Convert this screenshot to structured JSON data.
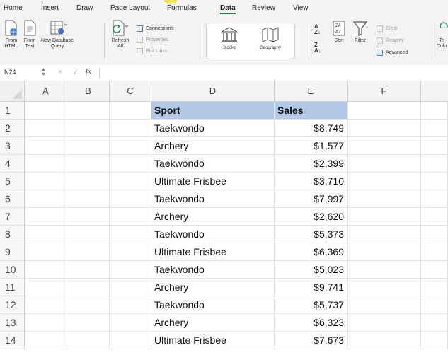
{
  "menu": {
    "tabs": [
      {
        "label": "Home"
      },
      {
        "label": "Insert"
      },
      {
        "label": "Draw"
      },
      {
        "label": "Page Layout"
      },
      {
        "label": "Formulas"
      },
      {
        "label": "Data",
        "active": true
      },
      {
        "label": "Review"
      },
      {
        "label": "View"
      }
    ]
  },
  "ribbon": {
    "from_html": "From\nHTML",
    "from_text": "From\nText",
    "new_db_query": "New Database\nQuery",
    "refresh_all": "Refresh\nAll",
    "connections": "Connections",
    "properties": "Properties",
    "edit_links": "Edit Links",
    "stocks": "Stocks",
    "geography": "Geography",
    "sort": "Sort",
    "filter": "Filter",
    "clear": "Clear",
    "reapply": "Reapply",
    "advanced": "Advanced",
    "text_to_columns": "Te\nColu"
  },
  "formula_bar": {
    "name_box": "N24",
    "fx_label": "fx",
    "cancel_symbol": "×",
    "enter_symbol": "✓"
  },
  "sheet": {
    "columns": [
      "A",
      "B",
      "C",
      "D",
      "E",
      "F"
    ],
    "rows": [
      {
        "num": "1",
        "sport": "Sport",
        "sales": "Sales",
        "header": true
      },
      {
        "num": "2",
        "sport": "Taekwondo",
        "sales": "$8,749"
      },
      {
        "num": "3",
        "sport": "Archery",
        "sales": "$1,577"
      },
      {
        "num": "4",
        "sport": "Taekwondo",
        "sales": "$2,399"
      },
      {
        "num": "5",
        "sport": "Ultimate Frisbee",
        "sales": "$3,710"
      },
      {
        "num": "6",
        "sport": "Taekwondo",
        "sales": "$7,997"
      },
      {
        "num": "7",
        "sport": "Archery",
        "sales": "$2,620"
      },
      {
        "num": "8",
        "sport": "Taekwondo",
        "sales": "$5,373"
      },
      {
        "num": "9",
        "sport": "Ultimate Frisbee",
        "sales": "$6,369"
      },
      {
        "num": "10",
        "sport": "Taekwondo",
        "sales": "$5,023"
      },
      {
        "num": "11",
        "sport": "Archery",
        "sales": "$9,741"
      },
      {
        "num": "12",
        "sport": "Taekwondo",
        "sales": "$5,737"
      },
      {
        "num": "13",
        "sport": "Archery",
        "sales": "$6,323"
      },
      {
        "num": "14",
        "sport": "Ultimate Frisbee",
        "sales": "$7,673"
      }
    ]
  },
  "colors": {
    "header_fill": "#b4c7e7",
    "accent": "#1f7a44"
  }
}
